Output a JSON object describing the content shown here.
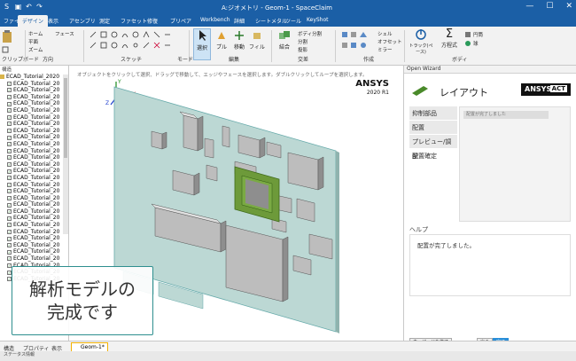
{
  "window": {
    "title": "A:ジオメトリ - Geom-1 - SpaceClaim",
    "min": "—",
    "max": "☐",
    "close": "✕"
  },
  "ribbon_tabs": [
    "ファイル",
    "デザイン",
    "表示",
    "アセンブリ",
    "測定",
    "ファセット",
    "修復",
    "プリペア",
    "Workbench",
    "詳細",
    "シートメタル",
    "ツール",
    "KeyShot"
  ],
  "active_tab_index": 1,
  "ribbon_groups": {
    "clipboard": "クリップボード",
    "orient": "方向",
    "sketch": "スケッチ",
    "mode": "モード",
    "edit": "編集",
    "intersect": "交差",
    "create": "作成",
    "body": "ボディ"
  },
  "ribbon_buttons": {
    "select": "選択",
    "pull": "プル",
    "move": "移動",
    "fill": "フィル",
    "combine": "結合",
    "split_body": "ボディ分割",
    "split": "分割",
    "project": "投影",
    "shell": "シェル",
    "offset": "オフセット",
    "mirror": "ミラー",
    "track": "トラック(ペース)",
    "equation": "方程式",
    "cylinder": "円筒",
    "sphere": "球",
    "home": "ホーム",
    "plane": "平面",
    "zoom": "ズーム",
    "surface": "フェース"
  },
  "tree": {
    "header": "構造",
    "root": "ECAD_Tutorial_2020",
    "items": [
      "ECAD_Tutorial_20",
      "ECAD_Tutorial_20",
      "ECAD_Tutorial_20",
      "ECAD_Tutorial_20",
      "ECAD_Tutorial_20",
      "ECAD_Tutorial_20",
      "ECAD_Tutorial_20",
      "ECAD_Tutorial_20",
      "ECAD_Tutorial_20",
      "ECAD_Tutorial_20",
      "ECAD_Tutorial_20",
      "ECAD_Tutorial_20",
      "ECAD_Tutorial_20",
      "ECAD_Tutorial_20",
      "ECAD_Tutorial_20",
      "ECAD_Tutorial_20",
      "ECAD_Tutorial_20",
      "ECAD_Tutorial_20",
      "ECAD_Tutorial_20",
      "ECAD_Tutorial_20",
      "ECAD_Tutorial_20",
      "ECAD_Tutorial_20",
      "ECAD_Tutorial_20",
      "ECAD_Tutorial_20",
      "ECAD_Tutorial_20",
      "ECAD_Tutorial_20",
      "ECAD_Tutorial_20",
      "ECAD_Tutorial_20",
      "ECAD_Tutorial_20",
      "ECAD_Tutorial_20"
    ]
  },
  "viewport": {
    "hint": "オブジェクトをクリックして選択、ドラッグで移動して、エッジやフェースを選択します。ダブルクリックしてループを選択します。",
    "brand": "ANSYS",
    "version": "2020 R1",
    "axis_y": "Y",
    "axis_x": "X",
    "axis_z": "Z"
  },
  "caption": {
    "line1": "解析モデルの",
    "line2": "完成です"
  },
  "wizard": {
    "header": "Open Wizard",
    "title": "レイアウト",
    "brand": "ANSYS",
    "brand_act": "ACT",
    "steps": [
      "抑制部品",
      "配置",
      "プレビュー/調整",
      "配置確定"
    ],
    "current_step": 3,
    "detail_input": "配置が完了しました",
    "help_title": "ヘルプ",
    "help_text": "配置が完了しました。",
    "btn_close": "ウィザードを終了",
    "btn_back": "戻る",
    "btn_next": "完了"
  },
  "bottom_tabs": {
    "structure": "構造",
    "properties": "プロパティ",
    "display": "表示",
    "doc": "Geom-1*"
  },
  "status": "ステータス情報"
}
